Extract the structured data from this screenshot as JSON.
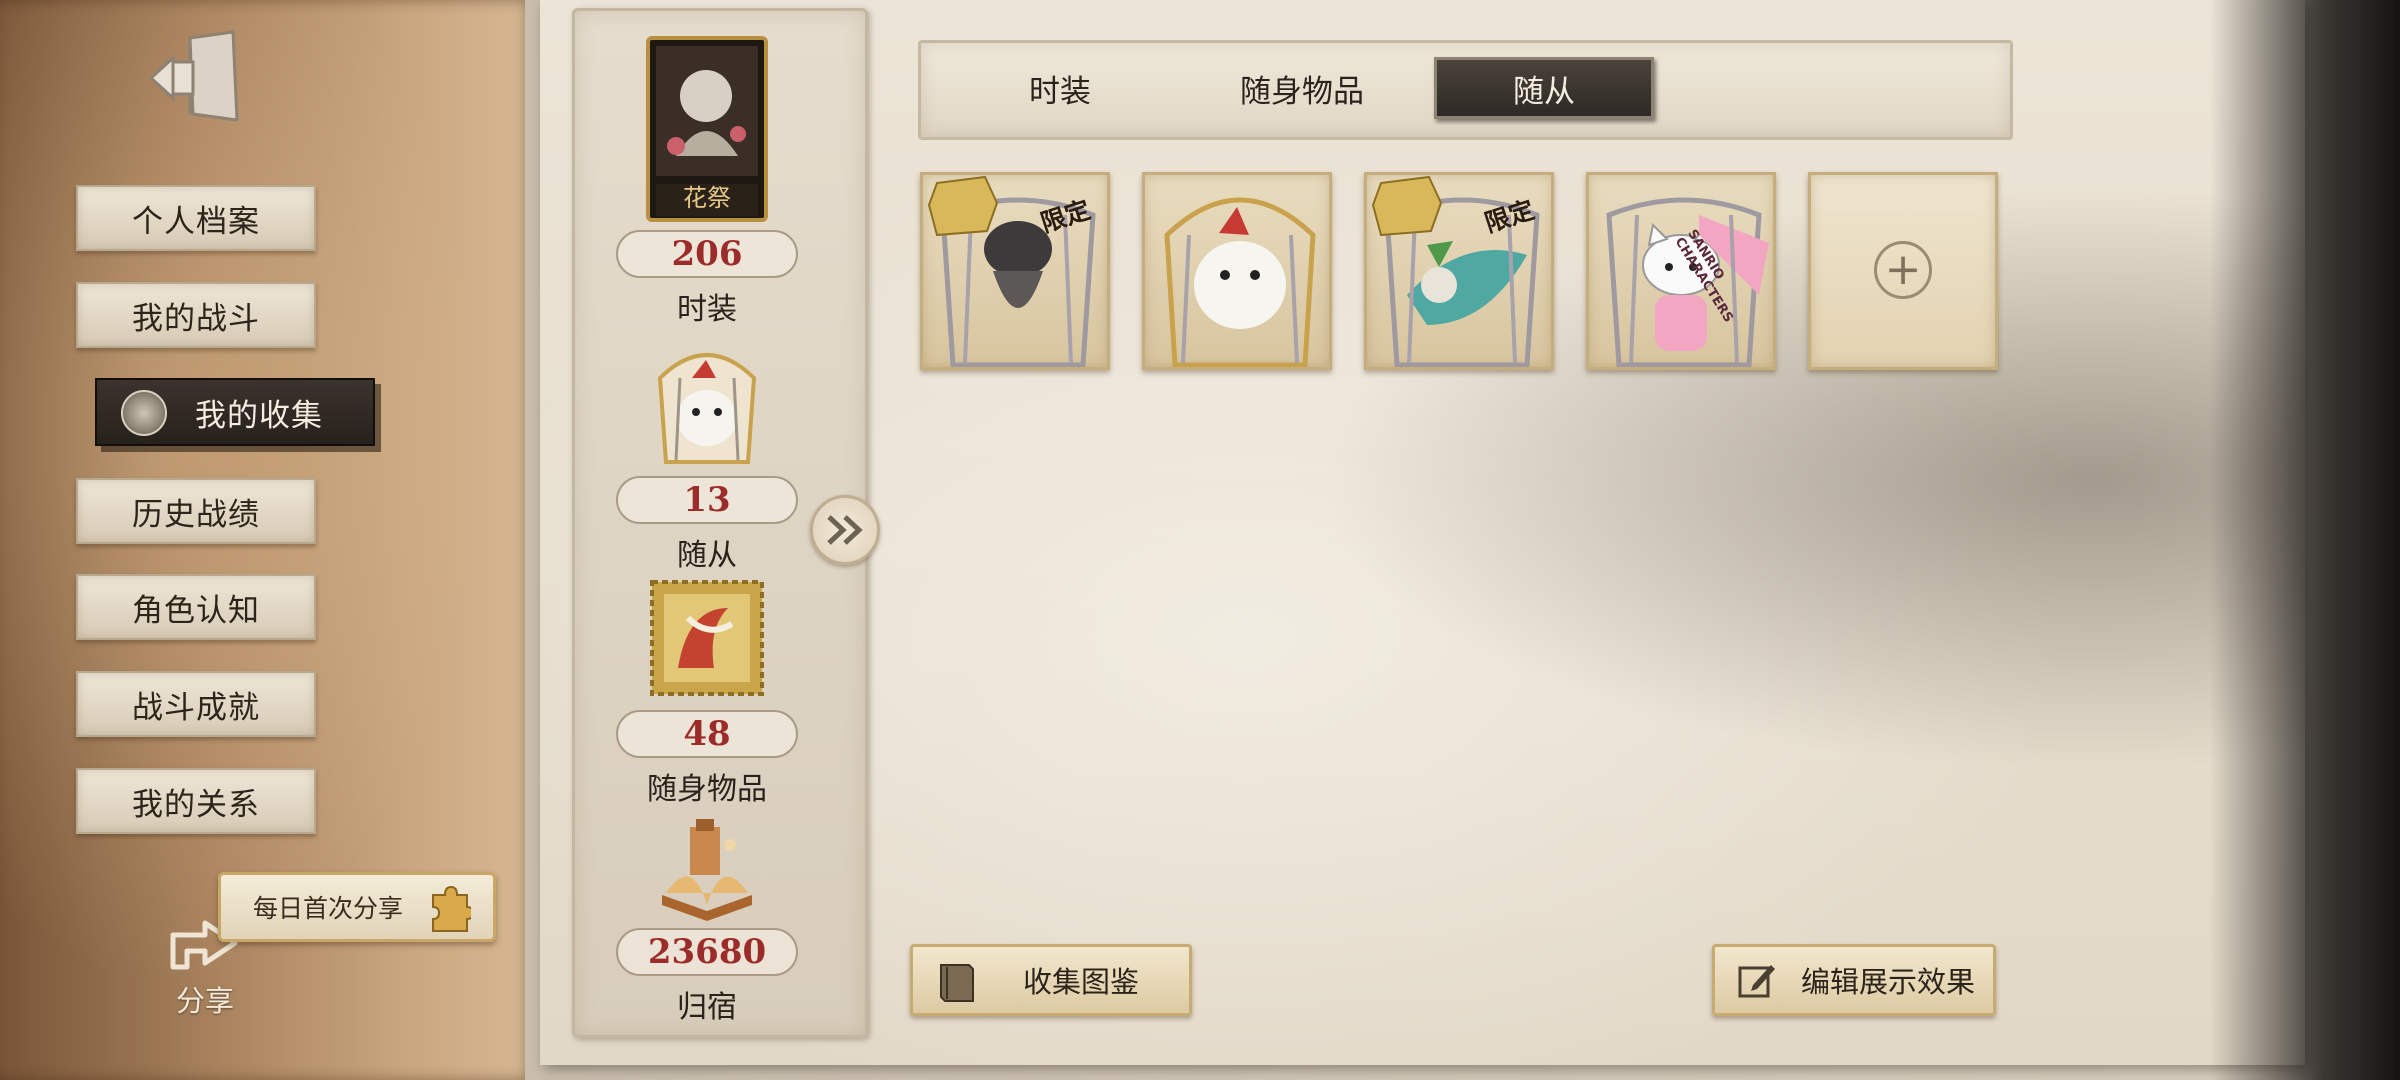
{
  "nav": {
    "items": [
      {
        "label": "个人档案"
      },
      {
        "label": "我的战斗"
      },
      {
        "label": "我的收集"
      },
      {
        "label": "历史战绩"
      },
      {
        "label": "角色认知"
      },
      {
        "label": "战斗成就"
      },
      {
        "label": "我的关系"
      }
    ],
    "active_index": 2
  },
  "share": {
    "bubble_text": "每日首次分享",
    "label": "分享"
  },
  "stats": {
    "portrait_caption": "花祭",
    "items": [
      {
        "value": "206",
        "label": "时装"
      },
      {
        "value": "13",
        "label": "随从"
      },
      {
        "value": "48",
        "label": "随身物品"
      },
      {
        "value": "23680",
        "label": "归宿"
      }
    ]
  },
  "tabs": {
    "items": [
      {
        "label": "时装"
      },
      {
        "label": "随身物品"
      },
      {
        "label": "随从"
      }
    ],
    "active_index": 2
  },
  "cards": [
    {
      "badge": "限定",
      "icon": "dark-creature-icon"
    },
    {
      "badge": "",
      "icon": "white-fox-icon"
    },
    {
      "badge": "限定",
      "icon": "masked-bird-icon"
    },
    {
      "badge": "",
      "icon": "hello-kitty-icon",
      "ribbon": "SANRIO CHARACTERS"
    },
    {
      "badge": "",
      "icon": "add-icon",
      "add_symbol": "+"
    }
  ],
  "buttons": {
    "codex": "收集图鉴",
    "edit_display": "编辑展示效果"
  },
  "colors": {
    "stat_value": "#9c2c2a",
    "active_tab": "#2e2924",
    "card_border": "#c6ad7d"
  }
}
